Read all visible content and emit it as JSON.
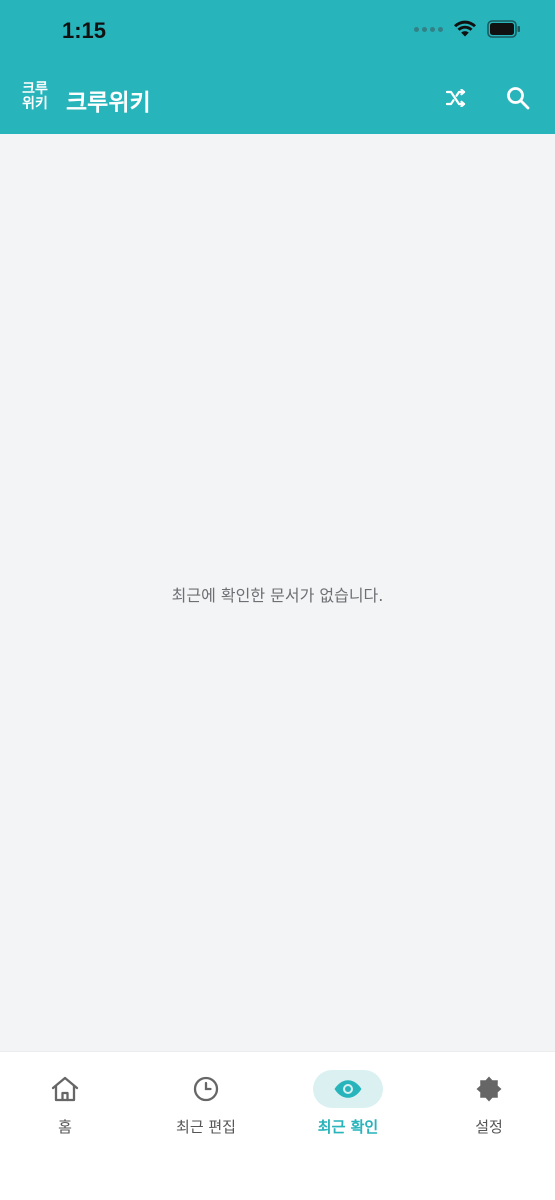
{
  "status_bar": {
    "time": "1:15"
  },
  "app_bar": {
    "logo_line1": "크루",
    "logo_line2": "위키",
    "title": "크루위키",
    "icons": [
      "shuffle-icon",
      "search-icon"
    ]
  },
  "main": {
    "empty_message": "최근에 확인한 문서가 없습니다."
  },
  "bottom_nav": {
    "items": [
      {
        "label": "홈",
        "icon": "home-icon",
        "active": false
      },
      {
        "label": "최근 편집",
        "icon": "clock-icon",
        "active": false
      },
      {
        "label": "최근 확인",
        "icon": "eye-icon",
        "active": true
      },
      {
        "label": "설정",
        "icon": "gear-icon",
        "active": false
      }
    ]
  },
  "colors": {
    "primary": "#27b4bb",
    "active_pill": "#daf0f1",
    "background": "#f3f4f6"
  }
}
